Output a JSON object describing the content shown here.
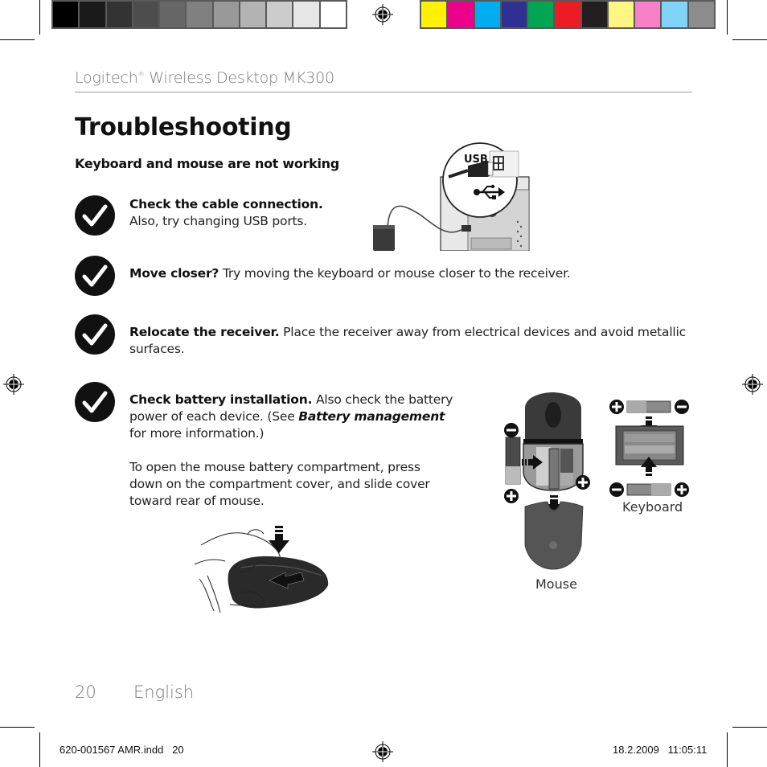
{
  "print_marks": {
    "gray_swatches": [
      "#000000",
      "#1a1a1a",
      "#333333",
      "#4d4d4d",
      "#666666",
      "#808080",
      "#999999",
      "#b3b3b3",
      "#cccccc",
      "#e6e6e6",
      "#ffffff"
    ],
    "color_swatches": [
      "#fff200",
      "#ec008c",
      "#00aeef",
      "#2e3192",
      "#00a651",
      "#ed1c24",
      "#231f20",
      "#fff582",
      "#f681c6",
      "#7fd4f8",
      "#8c8c8c"
    ]
  },
  "header": {
    "brand": "Logitech",
    "brand_mark": "®",
    "product": " Wireless Desktop MK300"
  },
  "page_title": "Troubleshooting",
  "section_title": "Keyboard and mouse are not working",
  "checklist": [
    {
      "bold": "Check the cable connection.",
      "text": "Also, try changing USB ports."
    },
    {
      "bold": "Move closer?",
      "text": " Try moving the keyboard or mouse closer to the receiver."
    },
    {
      "bold": "Relocate the receiver.",
      "text": " Place the receiver away from electrical devices and avoid metallic surfaces."
    },
    {
      "bold": "Check battery installation.",
      "text_before": " Also check the battery power of each device. (See ",
      "italic_bold": "Battery management",
      "text_after": " for more information.)"
    }
  ],
  "battery_instructions": "To open the mouse battery compartment, press down on the compartment cover, and slide cover toward rear of mouse.",
  "illustrations": {
    "usb_label": "USB",
    "mouse_caption": "Mouse",
    "keyboard_caption": "Keyboard"
  },
  "footer": {
    "page_number": "20",
    "language": "English",
    "slug_file": "620-001567 AMR.indd   20",
    "slug_date": "18.2.2009   11:05:11"
  }
}
